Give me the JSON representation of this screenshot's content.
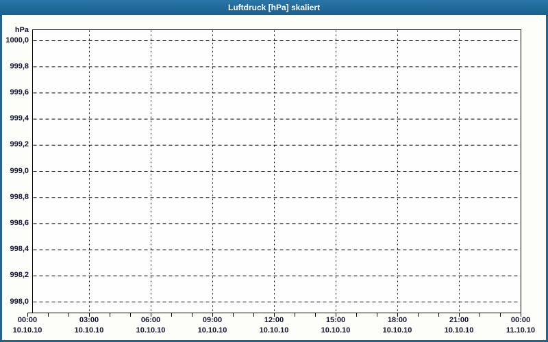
{
  "window": {
    "title": "Luftdruck [hPa] skaliert"
  },
  "colors": {
    "title_bar_top": "#2b76a8",
    "title_bar_bottom": "#17608e",
    "frame": "#20638f",
    "axis_text": "#101032",
    "grid_line": "#000000",
    "plot_background": "#fefefe",
    "window_background": "#fdfdfa",
    "title_text": "#ffffff"
  },
  "chart_data": {
    "type": "line",
    "title": "Luftdruck [hPa] skaliert",
    "ylabel": "hPa",
    "ylim": [
      998.0,
      1000.0
    ],
    "ytick_step": 0.2,
    "y_ticks": [
      "1000,0",
      "999,8",
      "999,6",
      "999,4",
      "999,2",
      "999,0",
      "998,8",
      "998,6",
      "998,4",
      "998,2",
      "998,0"
    ],
    "x_ticks": [
      {
        "time": "00:00",
        "date": "10.10.10"
      },
      {
        "time": "03:00",
        "date": "10.10.10"
      },
      {
        "time": "06:00",
        "date": "10.10.10"
      },
      {
        "time": "09:00",
        "date": "10.10.10"
      },
      {
        "time": "12:00",
        "date": "10.10.10"
      },
      {
        "time": "15:00",
        "date": "10.10.10"
      },
      {
        "time": "18:00",
        "date": "10.10.10"
      },
      {
        "time": "21:00",
        "date": "10.10.10"
      },
      {
        "time": "00:00",
        "date": "11.10.10"
      }
    ],
    "x_minor_ticks_per_major": 3,
    "grid": "dashed",
    "legend": "none",
    "series": []
  }
}
